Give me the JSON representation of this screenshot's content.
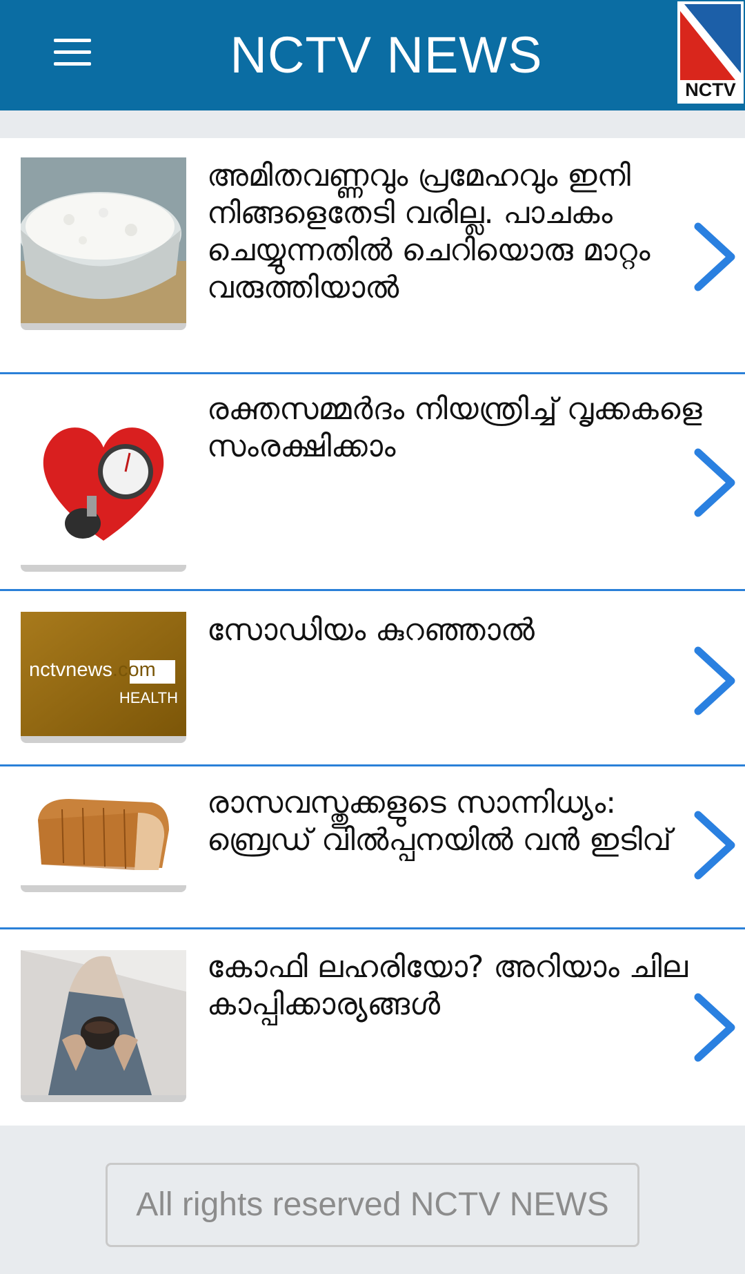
{
  "header": {
    "title": "NCTV NEWS",
    "menu_icon": "hamburger-menu-icon",
    "logo_text": "NCTV",
    "background_color": "#0b6da3"
  },
  "news": [
    {
      "headline": "അമിതവണ്ണവും പ്രമേഹവും ഇനി നിങ്ങളെതേടി വരില്ല. പാചകം ചെയ്യുന്നതിൽ ചെറിയൊരു മാറ്റം വരുത്തിയാൽ",
      "thumbnail": "rice-bowl-image"
    },
    {
      "headline": "രക്തസമ്മർദം നിയന്ത്രിച്ച് വൃക്കകളെ സംരക്ഷിക്കാം",
      "thumbnail": "heart-blood-pressure-image"
    },
    {
      "headline": "സോഡിയം കുറഞ്ഞാൽ",
      "thumbnail": "nctvnews-health-image",
      "thumbnail_text": {
        "brand": "nctvnews",
        "domain": ".com",
        "section": "HEALTH"
      }
    },
    {
      "headline": "രാസവസ്തുക്കളുടെ സാന്നിധ്യം: ബ്രെഡ് വിൽപ്പനയിൽ വൻ ഇടിവ്",
      "thumbnail": "bread-loaf-image"
    },
    {
      "headline": "കോഫി ലഹരിയോ? അറിയാം ചില കാപ്പിക്കാര്യങ്ങൾ",
      "thumbnail": "coffee-cup-image"
    }
  ],
  "chevron_color": "#2a80e0",
  "footer": {
    "text": "All rights reserved NCTV NEWS"
  }
}
